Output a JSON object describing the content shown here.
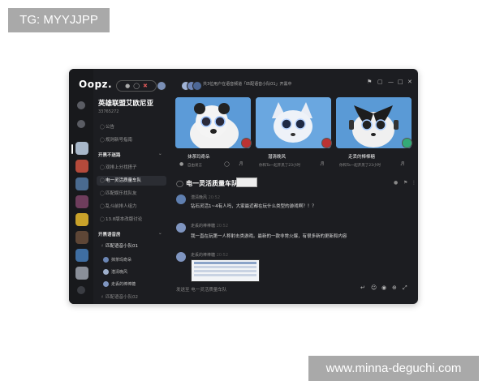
{
  "watermarks": {
    "top": "TG: MYYJJPP",
    "bottom": "www.minna-deguchi.com"
  },
  "app": {
    "logo": "Oopz.",
    "voice_bar": {
      "mic_icon": "mic-icon",
      "headphone_icon": "headphone-icon",
      "mute_icon": "mute-icon"
    },
    "top_notice": "共3位用户在语音频道「匹配语音小队01」开黑中",
    "window_controls": [
      "pin-icon",
      "square-icon",
      "minimize-icon",
      "restore-icon",
      "close-icon"
    ]
  },
  "server": {
    "title": "英雄联盟艾欧尼亚",
    "id": "33765272",
    "top_channels": [
      "公告",
      "规则新号指南"
    ],
    "categories": [
      {
        "label": "开黑不迷路",
        "channels": [
          "双排上分找搭子",
          "电一灵活质量车队",
          "匹配娱乐找队友",
          "乱斗前排人组力",
          "13.8版本改版讨论"
        ]
      },
      {
        "label": "开黑语音房",
        "voice_channel": "匹配语音小队01",
        "members": [
          "抹茶玛奇朵",
          "潜清晚风",
          "走丢的棒棒糖"
        ],
        "next_channel": "匹配语音小队02"
      }
    ]
  },
  "cards": [
    {
      "name": "抹茶玛奇朵",
      "status": "自由发言"
    },
    {
      "name": "潜清晚风",
      "status": "你和Ta一起开黑了23小时"
    },
    {
      "name": "走丢的棒棒糖",
      "status": "你和Ta一起开黑了23小时"
    }
  ],
  "chat": {
    "channel_title": "电一灵活质量车队",
    "messages": [
      {
        "author": "潜清晚风",
        "time": "20:52",
        "text": "钻石灵活1~4有人吗，大家最近都在玩什么类型的游戏啊？！？"
      },
      {
        "author": "走丢的棒棒糖",
        "time": "20:52",
        "text": "我一直在玩第一人称射击类游戏。最新的一款非常火爆，有很多新的更新和内容"
      },
      {
        "author": "走丢的棒棒糖",
        "time": "20:52",
        "text": ""
      }
    ],
    "input_placeholder": "发送至 电一灵活质量车队"
  },
  "colors": {
    "app_bg": "#1c1d21",
    "rail_bg": "#18191c",
    "card_sky": "#5c9bd8",
    "active_channel": "#2b2d33"
  }
}
